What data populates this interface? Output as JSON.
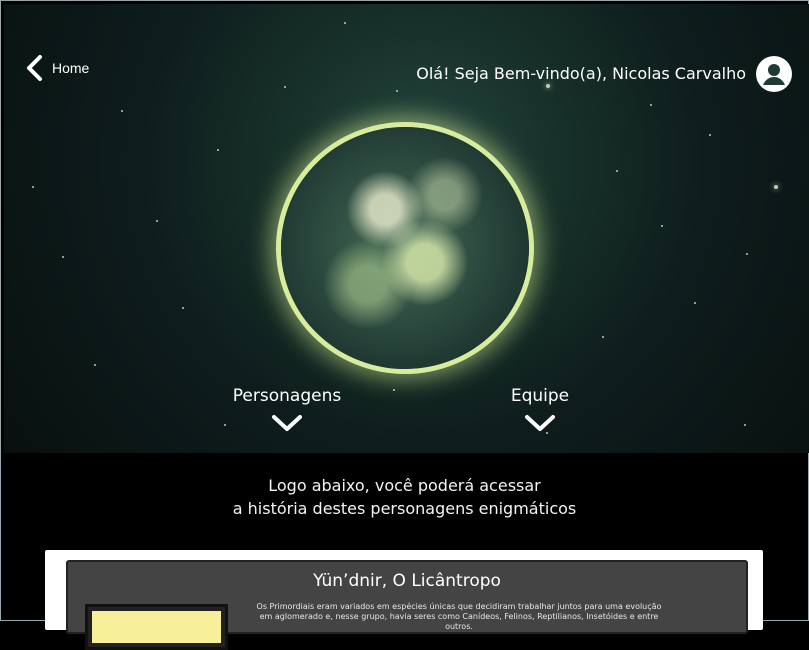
{
  "header": {
    "back_label": "Home",
    "greeting": "Olá! Seja Bem-vindo(a), Nicolas Carvalho"
  },
  "icons": {
    "back": "chevron-left-icon",
    "profile": "user-circle-icon",
    "expand": "chevron-down-icon",
    "planet": "earth-image"
  },
  "nav": {
    "personagens": "Personagens",
    "equipe": "Equipe"
  },
  "intro": {
    "line1": "Logo abaixo, você poderá acessar",
    "line2": "a história destes personagens enigmáticos"
  },
  "card": {
    "title": "Yün’dnir, O Licântropo",
    "text": "Os Primordiais eram variados em espécies únicas que decidiram trabalhar juntos para uma evolução em aglomerado e, nesse grupo, havia seres como Canídeos, Felinos, Reptilianos, Insetóides e entre outros."
  },
  "colors": {
    "background": "#000000",
    "hero_top": "#173029",
    "planet_glow": "#d8ec9d",
    "card_bg": "#444444",
    "card_border": "#ffffff",
    "thumb": "#f7ef99"
  }
}
